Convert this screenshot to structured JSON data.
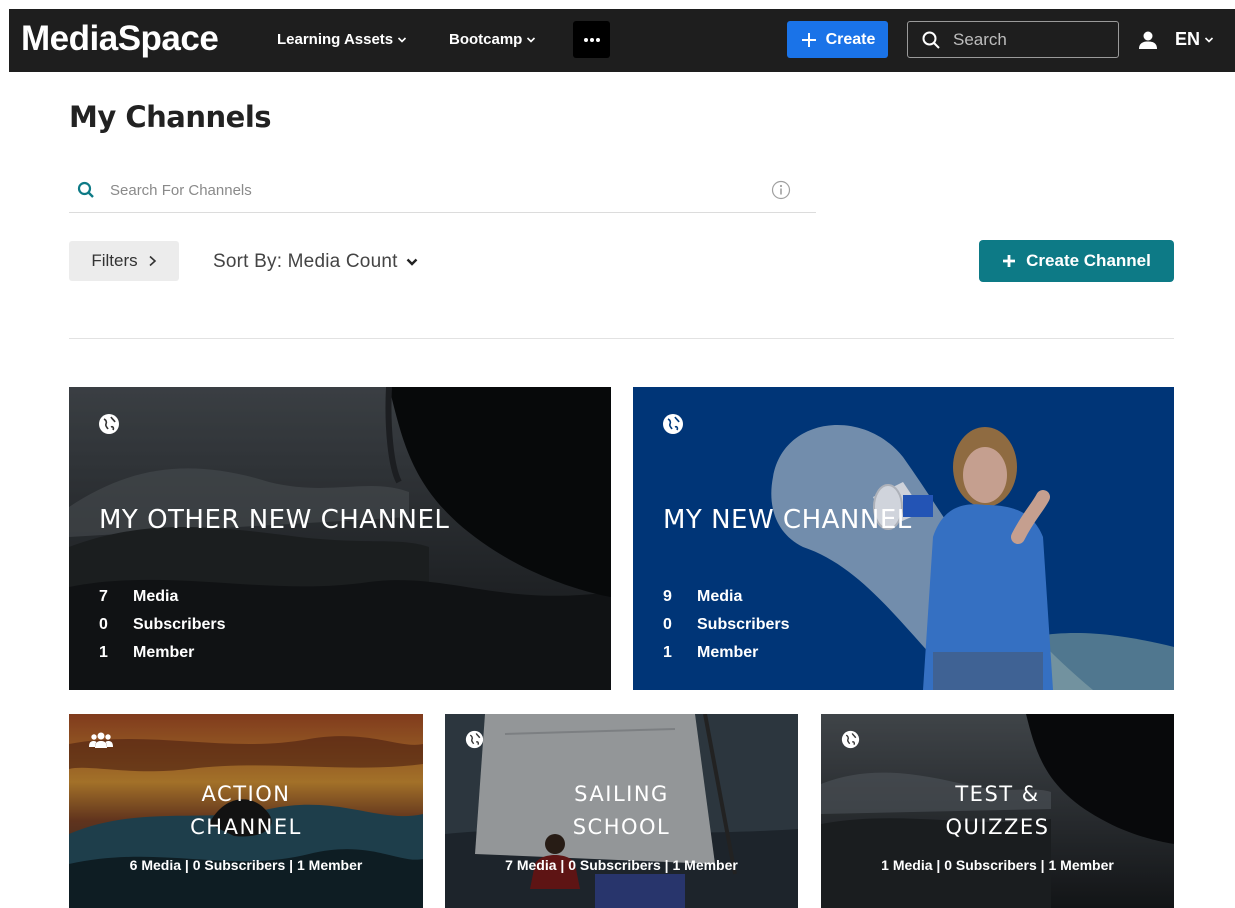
{
  "app": {
    "brand": "MediaSpace",
    "nav": [
      {
        "label": "Learning Assets"
      },
      {
        "label": "Bootcamp"
      }
    ],
    "create_label": "Create",
    "search_placeholder": "Search",
    "language": "EN"
  },
  "page": {
    "title": "My Channels",
    "channel_search_placeholder": "Search For Channels",
    "filters_label": "Filters",
    "sort_label": "Sort By: Media Count",
    "create_channel_label": "Create Channel"
  },
  "channels": [
    {
      "title": "MY OTHER NEW CHANNEL",
      "visibility_icon": "globe-icon",
      "stats": [
        {
          "num": "7",
          "label": "Media"
        },
        {
          "num": "0",
          "label": "Subscribers"
        },
        {
          "num": "1",
          "label": "Member"
        }
      ]
    },
    {
      "title": "MY NEW CHANNEL",
      "visibility_icon": "globe-icon",
      "stats": [
        {
          "num": "9",
          "label": "Media"
        },
        {
          "num": "0",
          "label": "Subscribers"
        },
        {
          "num": "1",
          "label": "Member"
        }
      ]
    },
    {
      "title_line1": "ACTION",
      "title_line2": "CHANNEL",
      "visibility_icon": "group-icon",
      "summary": "6 Media |  0 Subscribers   |   1 Member"
    },
    {
      "title_line1": "SAILING",
      "title_line2": "SCHOOL",
      "visibility_icon": "globe-icon",
      "summary": "7 Media |  0 Subscribers   |   1 Member"
    },
    {
      "title_line1": "TEST &",
      "title_line2": "QUIZZES",
      "visibility_icon": "globe-icon",
      "summary": "1 Media |  0 Subscribers   |   1 Member"
    }
  ],
  "colors": {
    "topbar": "#1e1e1e",
    "create_button": "#1a73e8",
    "create_channel_button": "#0d7a86",
    "new_channel_bg": "#003a7e"
  }
}
